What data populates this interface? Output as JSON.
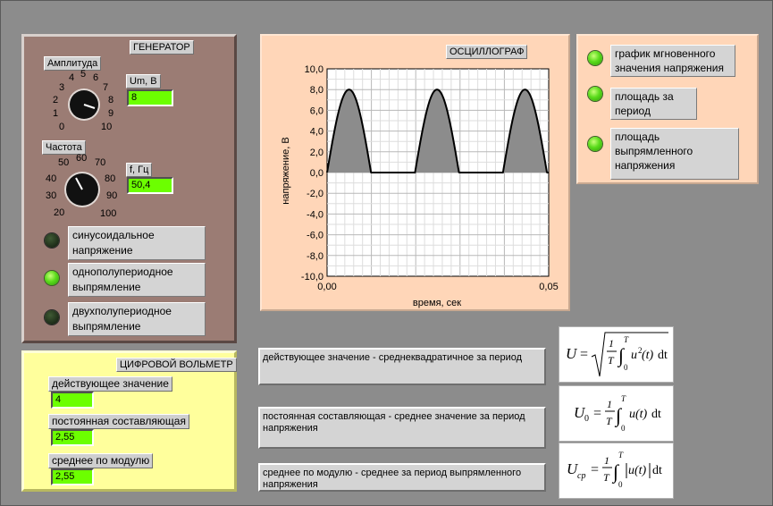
{
  "generator": {
    "title": "ГЕНЕРАТОР",
    "amplitude_label": "Амплитуда",
    "amplitude_scale": [
      "0",
      "1",
      "2",
      "3",
      "4",
      "5",
      "6",
      "7",
      "8",
      "9",
      "10"
    ],
    "um_label": "Um, B",
    "um_value": "8",
    "frequency_label": "Частота",
    "frequency_scale": [
      "20",
      "30",
      "40",
      "50",
      "60",
      "70",
      "80",
      "90",
      "100"
    ],
    "f_label": "f, Гц",
    "f_value": "50,4",
    "modes": [
      {
        "label_l1": "синусоидальное",
        "label_l2": "напряжение",
        "active": false
      },
      {
        "label_l1": "однополупериодное",
        "label_l2": "выпрямление",
        "active": true
      },
      {
        "label_l1": "двухполупериодное",
        "label_l2": "выпрямление",
        "active": false
      }
    ]
  },
  "oscilloscope": {
    "title": "ОСЦИЛЛОГРАФ",
    "chart_data": {
      "type": "area",
      "xlabel": "время, сек",
      "ylabel": "напряжение, В",
      "xlim": [
        0,
        0.05
      ],
      "ylim": [
        -10,
        10
      ],
      "y_ticks": [
        "10,0",
        "8,0",
        "6,0",
        "4,0",
        "2,0",
        "0,0",
        "-2,0",
        "-4,0",
        "-6,0",
        "-8,0",
        "-10,0"
      ],
      "x_ticks": [
        "0,00",
        "0,05"
      ],
      "amplitude": 8,
      "frequency": 50.4,
      "waveform": "half-wave rectified sine",
      "fill_color": "#8c8c8c",
      "grid": true
    }
  },
  "selector": {
    "items": [
      {
        "label_l1": "график мгновенного",
        "label_l2": "значения напряжения",
        "label_l3": ""
      },
      {
        "label_l1": "площадь за",
        "label_l2": "период",
        "label_l3": ""
      },
      {
        "label_l1": "площадь",
        "label_l2": "выпрямленного",
        "label_l3": "напряжения"
      }
    ]
  },
  "voltmeter": {
    "title": "ЦИФРОВОЙ ВОЛЬМЕТР",
    "rms_label": "действующее значение",
    "rms_value": "4",
    "dc_label": "постоянная составляющая",
    "dc_value": "2,55",
    "abs_label": "среднее по модулю",
    "abs_value": "2,55"
  },
  "descriptions": {
    "rms": "действующее значение - среднеквадратичное за период",
    "dc": "постоянная составляющая - среднее значение за период напряжения",
    "abs": "среднее по модулю - среднее за период выпрямленного напряжения"
  },
  "formulas": {
    "rms_lhs": "U",
    "dc_lhs": "U",
    "dc_sub": "0",
    "abs_lhs": "U",
    "abs_sub": "ср"
  }
}
